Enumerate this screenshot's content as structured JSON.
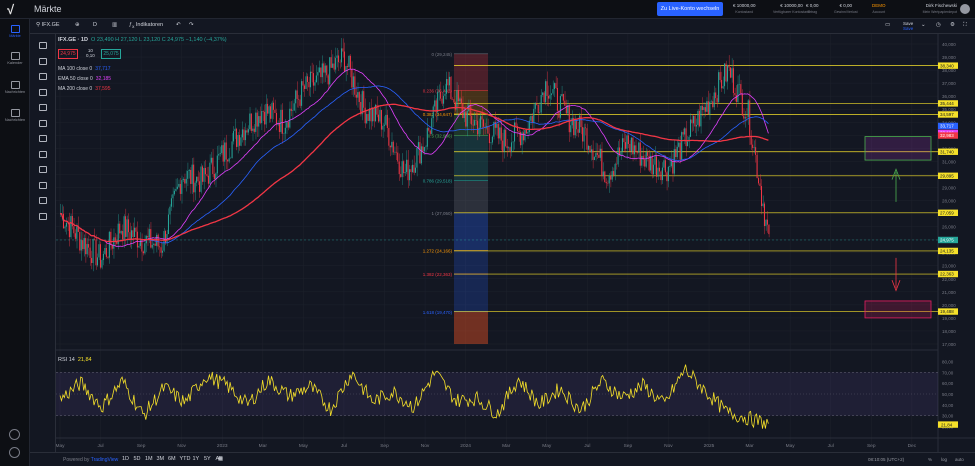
{
  "app": {
    "title": "Märkte",
    "logo": "√",
    "live_button": "Zu Live-Konto wechseln"
  },
  "account": [
    {
      "value": "€ 10000,00",
      "label": "Kontostand"
    },
    {
      "value": "€ 10000,00",
      "label": "Verfügbarer Kontostand"
    },
    {
      "value": "€ 0,00",
      "label": "Ertrag"
    },
    {
      "value": "€ 0,00",
      "label": "Gewinn/Verlust"
    },
    {
      "value": "DEMO",
      "label": "Account"
    }
  ],
  "user": {
    "name": "Dirk Fischewski",
    "sub": "Mein Wertpapierdepot"
  },
  "nav": [
    {
      "label": "Märkte"
    },
    {
      "label": "Kalender"
    },
    {
      "label": "Nachrichten"
    },
    {
      "label": "Nachrichten"
    }
  ],
  "toolbar": {
    "symbol": "IFX.GE",
    "interval": "D",
    "indicators": "Indikatoren",
    "save": "Save",
    "save_sub": "Save"
  },
  "legend": {
    "symbol": "IFX.GE · 1D",
    "ohlc": "O 23,490  H 27,120  L 23,120  C 24,975 −1,140 (−4,37%)",
    "sell": "24,975",
    "buy": "25,075",
    "spread_top": "10",
    "spread_bot": "0,10",
    "indicators": [
      {
        "name": "MA 100 close 0",
        "value": "37,717",
        "color": "#2962ff"
      },
      {
        "name": "EMA 50 close 0",
        "value": "32,185",
        "color": "#e040fb"
      },
      {
        "name": "MA 200 close 0",
        "value": "37,595",
        "color": "#f23645"
      }
    ],
    "rsi": {
      "name": "RSI 14",
      "value": "21,84"
    }
  },
  "fib": [
    {
      "label": "0 (29,245)",
      "color": "#787b86"
    },
    {
      "label": "0.236 (36,441)",
      "color": "#f23645"
    },
    {
      "label": "0.382 (34,647)",
      "color": "#ff9800"
    },
    {
      "label": "0.5 (32,996)",
      "color": "#4caf50"
    },
    {
      "label": "0.786 (29,518)",
      "color": "#26a69a"
    },
    {
      "label": "1 (27,050)",
      "color": "#787b86"
    },
    {
      "label": "1.272 (24,166)",
      "color": "#ff9800"
    },
    {
      "label": "1.382 (22,363)",
      "color": "#f23645"
    },
    {
      "label": "1.618 (19,470)",
      "color": "#2962ff"
    }
  ],
  "price_axis": [
    "40,000",
    "39,000",
    "38,000",
    "37,000",
    "36,000",
    "35,000",
    "34,000",
    "33,000",
    "32,000",
    "31,000",
    "30,000",
    "29,000",
    "28,000",
    "27,000",
    "26,000",
    "25,000",
    "24,000",
    "23,000",
    "22,000",
    "21,000",
    "20,000",
    "19,000",
    "18,000",
    "17,000"
  ],
  "price_tags": [
    {
      "label": "38,340",
      "color": "#f5e02a",
      "text": "#131722"
    },
    {
      "label": "35,444",
      "color": "#f5e02a",
      "text": "#131722"
    },
    {
      "label": "34,597",
      "color": "#f5e02a",
      "text": "#131722"
    },
    {
      "label": "33,717",
      "color": "#2962ff",
      "text": "#ffffff"
    },
    {
      "label": "33,186",
      "color": "#e040fb",
      "text": "#ffffff"
    },
    {
      "label": "32,983",
      "color": "#f23645",
      "text": "#ffffff"
    },
    {
      "label": "31,740",
      "color": "#f5e02a",
      "text": "#131722"
    },
    {
      "label": "29,895",
      "color": "#f5e02a",
      "text": "#131722"
    },
    {
      "label": "27,059",
      "color": "#f5e02a",
      "text": "#131722"
    },
    {
      "label": "24,975",
      "color": "#26a69a",
      "text": "#ffffff"
    },
    {
      "label": "24,135",
      "color": "#f5e02a",
      "text": "#131722"
    },
    {
      "label": "22,363",
      "color": "#f5e02a",
      "text": "#131722"
    },
    {
      "label": "19,488",
      "color": "#f5e02a",
      "text": "#131722"
    }
  ],
  "rsi_axis": [
    "80,00",
    "70,00",
    "60,00",
    "50,00",
    "40,00",
    "30,00",
    "20,00"
  ],
  "rsi_tag": "21,84",
  "time_axis": [
    "May",
    "Jul",
    "Sep",
    "Nov",
    "2023",
    "Mar",
    "May",
    "Jul",
    "Sep",
    "Nov",
    "2024",
    "Mar",
    "May",
    "Jul",
    "Sep",
    "Nov",
    "2025",
    "Mar",
    "May",
    "Jul",
    "Sep",
    "Dec"
  ],
  "timeframes": [
    "1D",
    "5D",
    "1M",
    "3M",
    "6M",
    "YTD",
    "1Y",
    "5Y",
    "All"
  ],
  "brand": {
    "pre": "Powered by",
    "name": "TradingView"
  },
  "bottom_right": {
    "time": "08:10:05 (UTC+2)",
    "pct": "%",
    "log": "log",
    "auto": "auto"
  },
  "chart_data": {
    "type": "candlestick",
    "symbol": "IFX.GE",
    "interval": "1D",
    "ylim": [
      17,
      40
    ],
    "close_path": [
      [
        "2022-05",
        27.0
      ],
      [
        "2022-06",
        25.0
      ],
      [
        "2022-07",
        23.5
      ],
      [
        "2022-08",
        26.0
      ],
      [
        "2022-09",
        25.0
      ],
      [
        "2022-10",
        24.5
      ],
      [
        "2022-11",
        30.0
      ],
      [
        "2022-12",
        29.5
      ],
      [
        "2023-01",
        31.5
      ],
      [
        "2023-02",
        33.5
      ],
      [
        "2023-03",
        35.0
      ],
      [
        "2023-04",
        34.0
      ],
      [
        "2023-05",
        36.5
      ],
      [
        "2023-06",
        37.5
      ],
      [
        "2023-07",
        39.0
      ],
      [
        "2023-08",
        35.0
      ],
      [
        "2023-09",
        34.0
      ],
      [
        "2023-10",
        30.0
      ],
      [
        "2023-11",
        32.5
      ],
      [
        "2023-12",
        37.0
      ],
      [
        "2024-01",
        34.5
      ],
      [
        "2024-02",
        33.5
      ],
      [
        "2024-03",
        32.5
      ],
      [
        "2024-04",
        33.5
      ],
      [
        "2024-05",
        37.0
      ],
      [
        "2024-06",
        34.5
      ],
      [
        "2024-07",
        33.0
      ],
      [
        "2024-08",
        30.0
      ],
      [
        "2024-09",
        32.5
      ],
      [
        "2024-10",
        31.0
      ],
      [
        "2024-11",
        30.5
      ],
      [
        "2024-12",
        33.0
      ],
      [
        "2025-01",
        35.5
      ],
      [
        "2025-02",
        38.0
      ],
      [
        "2025-03",
        34.5
      ],
      [
        "2025-04",
        25.0
      ]
    ],
    "rsi_path": [
      45,
      60,
      38,
      62,
      30,
      56,
      42,
      67,
      58,
      40,
      63,
      48,
      57,
      36,
      70,
      43,
      52,
      38,
      70,
      44,
      46,
      32,
      64,
      40,
      55,
      35,
      62,
      47,
      58,
      40,
      73,
      52,
      33,
      28,
      22
    ]
  }
}
